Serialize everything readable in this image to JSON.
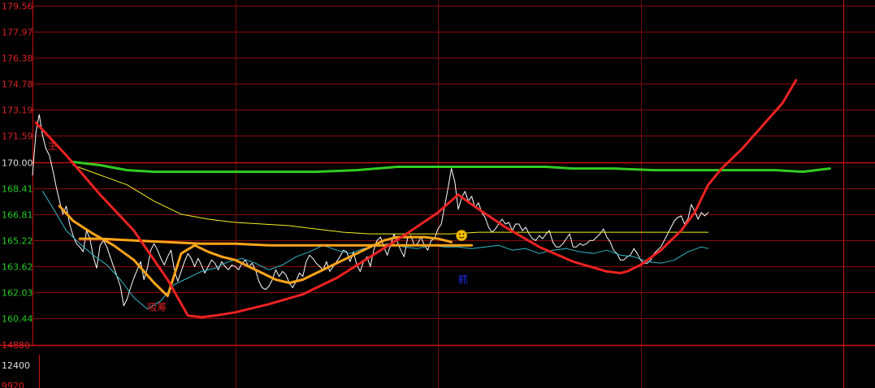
{
  "chart_data": {
    "type": "line",
    "price_axis": {
      "ticks": [
        "179.56",
        "177.97",
        "176.38",
        "174.78",
        "173.19",
        "171.59",
        "170.00",
        "168.41",
        "166.81",
        "165.22",
        "163.62",
        "162.03",
        "160.44"
      ],
      "ylim": [
        159.6,
        179.56
      ],
      "reference": 170.0
    },
    "volume_axis": {
      "ticks": [
        "14880",
        "12400",
        "9920"
      ],
      "ylim": [
        9920,
        14880
      ]
    },
    "x_range": [
      0,
      240
    ],
    "vertical_grid_x": [
      60,
      120,
      180,
      240
    ],
    "annotations": [
      {
        "text": "主",
        "x": 4.5,
        "y": 170.8,
        "color": "#dd2222"
      },
      {
        "text": "吸筹",
        "x": 34,
        "y": 160.9,
        "color": "#dd2222"
      },
      {
        "text": "抓",
        "x": 126,
        "y": 162.6,
        "color": "#2233ff"
      }
    ],
    "smiley": {
      "x": 127,
      "y": 165.5
    },
    "series": [
      {
        "color": "#ffffff",
        "x": [
          0,
          1,
          2,
          3,
          4,
          5,
          6,
          7,
          8,
          9,
          10,
          11,
          12,
          13,
          14,
          15,
          16,
          17,
          18,
          19,
          20,
          21,
          22,
          23,
          24,
          25,
          26,
          27,
          28,
          29,
          30,
          31,
          32,
          33,
          34,
          35,
          36,
          37,
          38,
          39,
          40,
          41,
          42,
          43,
          44,
          45,
          46,
          47,
          48,
          49,
          50,
          51,
          52,
          53,
          54,
          55,
          56,
          57,
          58,
          59,
          60,
          61,
          62,
          63,
          64,
          65,
          66,
          67,
          68,
          69,
          70,
          71,
          72,
          73,
          74,
          75,
          76,
          77,
          78,
          79,
          80,
          81,
          82,
          83,
          84,
          85,
          86,
          87,
          88,
          89,
          90,
          91,
          92,
          93,
          94,
          95,
          96,
          97,
          98,
          99,
          100,
          101,
          102,
          103,
          104,
          105,
          106,
          107,
          108,
          109,
          110,
          111,
          112,
          113,
          114,
          115,
          116,
          117,
          118,
          119,
          120,
          121,
          122,
          123,
          124,
          125,
          126,
          127,
          128,
          129,
          130,
          131,
          132,
          133,
          134,
          135,
          136,
          137,
          138,
          139,
          140,
          141,
          142,
          143,
          144,
          145,
          146,
          147,
          148,
          149,
          150,
          151,
          152,
          153,
          154,
          155,
          156,
          157,
          158,
          159,
          160,
          161,
          162,
          163,
          164,
          165,
          166,
          167,
          168,
          169,
          170,
          171,
          172,
          173,
          174,
          175,
          176,
          177,
          178,
          179,
          180,
          181,
          182,
          183,
          184,
          185,
          186,
          187,
          188,
          189,
          190,
          191,
          192,
          193,
          194,
          195,
          196,
          197,
          198,
          199,
          200
        ],
        "y": [
          169.2,
          171.8,
          172.9,
          171.6,
          170.8,
          170.4,
          169.5,
          168.5,
          167.6,
          166.8,
          167.3,
          166.2,
          165.5,
          165.0,
          164.8,
          164.5,
          165.8,
          165.3,
          164.2,
          163.5,
          164.9,
          165.2,
          164.8,
          164.2,
          163.6,
          163.0,
          162.4,
          161.2,
          161.6,
          162.3,
          162.9,
          163.4,
          163.9,
          162.8,
          163.5,
          164.6,
          165.0,
          164.6,
          164.1,
          163.7,
          164.2,
          164.6,
          163.4,
          162.7,
          163.3,
          163.9,
          164.4,
          164.1,
          163.6,
          164.1,
          163.7,
          163.2,
          163.6,
          164.0,
          163.8,
          163.4,
          163.9,
          163.6,
          163.4,
          163.7,
          163.6,
          163.4,
          163.8,
          164.0,
          163.6,
          163.8,
          163.4,
          162.7,
          162.3,
          162.2,
          162.4,
          162.8,
          163.4,
          163.0,
          163.3,
          163.1,
          162.6,
          162.3,
          162.7,
          163.2,
          163.0,
          163.9,
          164.3,
          164.1,
          163.8,
          163.6,
          163.4,
          163.9,
          163.3,
          163.6,
          163.9,
          164.2,
          164.6,
          164.5,
          163.9,
          164.5,
          163.7,
          163.3,
          163.9,
          164.2,
          163.6,
          164.6,
          165.2,
          165.4,
          164.8,
          164.3,
          164.9,
          165.6,
          165.1,
          164.6,
          164.2,
          165.3,
          165.5,
          164.9,
          165.0,
          165.4,
          164.9,
          164.6,
          165.2,
          165.3,
          165.9,
          166.2,
          167.3,
          168.4,
          169.6,
          168.8,
          167.1,
          167.8,
          168.2,
          167.6,
          167.9,
          167.2,
          167.5,
          166.9,
          166.6,
          166.0,
          165.7,
          165.9,
          166.2,
          166.5,
          166.2,
          166.3,
          165.8,
          166.2,
          166.2,
          165.8,
          166.0,
          165.6,
          165.3,
          165.2,
          165.5,
          165.3,
          165.6,
          165.8,
          165.1,
          164.8,
          164.8,
          165.0,
          165.3,
          165.6,
          164.8,
          164.8,
          165.0,
          164.9,
          165.0,
          165.2,
          165.2,
          165.4,
          165.6,
          165.9,
          165.4,
          165.1,
          164.6,
          164.4,
          164.0,
          164.0,
          164.2,
          164.3,
          164.7,
          164.4,
          164.0,
          163.8,
          163.8,
          164.0,
          164.4,
          164.6,
          164.8,
          165.2,
          165.6,
          166.0,
          166.4,
          166.6,
          166.7,
          166.2,
          166.5,
          167.4,
          167.0,
          166.5,
          166.9,
          166.7,
          166.9
        ]
      },
      {
        "color": "#33bbcc",
        "x": [
          3,
          6,
          10,
          14,
          18,
          22,
          26,
          30,
          34,
          38,
          42,
          46,
          50,
          54,
          58,
          62,
          66,
          70,
          74,
          78,
          82,
          86,
          90,
          94,
          98,
          102,
          106,
          110,
          114,
          118,
          122,
          126,
          130,
          134,
          138,
          142,
          146,
          150,
          154,
          158,
          162,
          166,
          170,
          174,
          178,
          182,
          186,
          190,
          194,
          198,
          200
        ],
        "y": [
          168.2,
          167.2,
          165.8,
          165.0,
          164.3,
          163.7,
          162.8,
          161.7,
          161.0,
          161.5,
          162.5,
          162.9,
          163.3,
          163.5,
          163.9,
          164.1,
          163.8,
          163.4,
          163.7,
          164.2,
          164.5,
          164.9,
          164.6,
          164.4,
          164.7,
          164.9,
          165.0,
          164.8,
          164.7,
          164.9,
          164.8,
          164.8,
          164.7,
          164.8,
          164.9,
          164.6,
          164.7,
          164.4,
          164.6,
          164.7,
          164.5,
          164.4,
          164.6,
          164.3,
          164.2,
          163.9,
          163.8,
          164.0,
          164.5,
          164.8,
          164.7
        ]
      },
      {
        "color": "#f2f222",
        "x": [
          12,
          20,
          28,
          36,
          44,
          52,
          60,
          68,
          76,
          84,
          92,
          100,
          108,
          116,
          124,
          132,
          140,
          148,
          156,
          164,
          172,
          180,
          188,
          196,
          200
        ],
        "y": [
          169.8,
          169.2,
          168.6,
          167.6,
          166.8,
          166.5,
          166.3,
          166.2,
          166.1,
          165.9,
          165.7,
          165.6,
          165.6,
          165.6,
          165.6,
          165.7,
          165.7,
          165.7,
          165.7,
          165.7,
          165.7,
          165.7,
          165.7,
          165.7,
          165.7
        ]
      },
      {
        "color": "#ffa51a",
        "x": [
          8,
          12,
          18,
          24,
          30,
          36,
          40,
          44,
          48,
          52,
          56,
          60,
          64,
          68,
          72,
          76,
          80,
          84,
          88,
          92,
          96,
          100,
          104,
          108,
          112,
          116,
          120,
          124
        ],
        "y": [
          167.3,
          166.4,
          165.6,
          164.9,
          164.0,
          162.6,
          161.8,
          164.4,
          164.9,
          164.5,
          164.2,
          164.0,
          163.6,
          163.2,
          162.8,
          162.6,
          162.8,
          163.2,
          163.6,
          164.0,
          164.4,
          164.8,
          165.2,
          165.4,
          165.4,
          165.4,
          165.3,
          165.1
        ]
      },
      {
        "color": "#ffa51a",
        "x": [
          14,
          20,
          30,
          40,
          50,
          60,
          70,
          80,
          90,
          100,
          110,
          120,
          130
        ],
        "y": [
          165.3,
          165.3,
          165.2,
          165.1,
          165.0,
          165.0,
          164.9,
          164.9,
          164.9,
          164.9,
          164.9,
          164.9,
          164.9
        ]
      },
      {
        "color": "#33cc22",
        "x": [
          12,
          20,
          28,
          36,
          48,
          60,
          72,
          84,
          96,
          108,
          120,
          132,
          144,
          152,
          160,
          172,
          184,
          196,
          208,
          220,
          228,
          232,
          236
        ],
        "y": [
          170.0,
          169.8,
          169.5,
          169.4,
          169.4,
          169.4,
          169.4,
          169.4,
          169.5,
          169.7,
          169.7,
          169.7,
          169.7,
          169.7,
          169.6,
          169.6,
          169.5,
          169.5,
          169.5,
          169.5,
          169.4,
          169.5,
          169.6
        ]
      },
      {
        "color": "#ee2222",
        "x": [
          1,
          10,
          20,
          30,
          40,
          46,
          50,
          54,
          60,
          70,
          80,
          90,
          100,
          110,
          120,
          126,
          130,
          140,
          150,
          160,
          170,
          174,
          176,
          180,
          186,
          192,
          196,
          200,
          204,
          210,
          216,
          222,
          226
        ],
        "y": [
          172.4,
          170.4,
          168.0,
          165.8,
          162.8,
          160.6,
          160.5,
          160.6,
          160.8,
          161.3,
          161.9,
          162.9,
          164.2,
          165.5,
          166.9,
          168.0,
          167.4,
          166.0,
          164.8,
          163.9,
          163.3,
          163.2,
          163.3,
          163.7,
          164.6,
          165.8,
          166.9,
          168.6,
          169.6,
          170.8,
          172.2,
          173.6,
          175.0
        ]
      }
    ]
  }
}
